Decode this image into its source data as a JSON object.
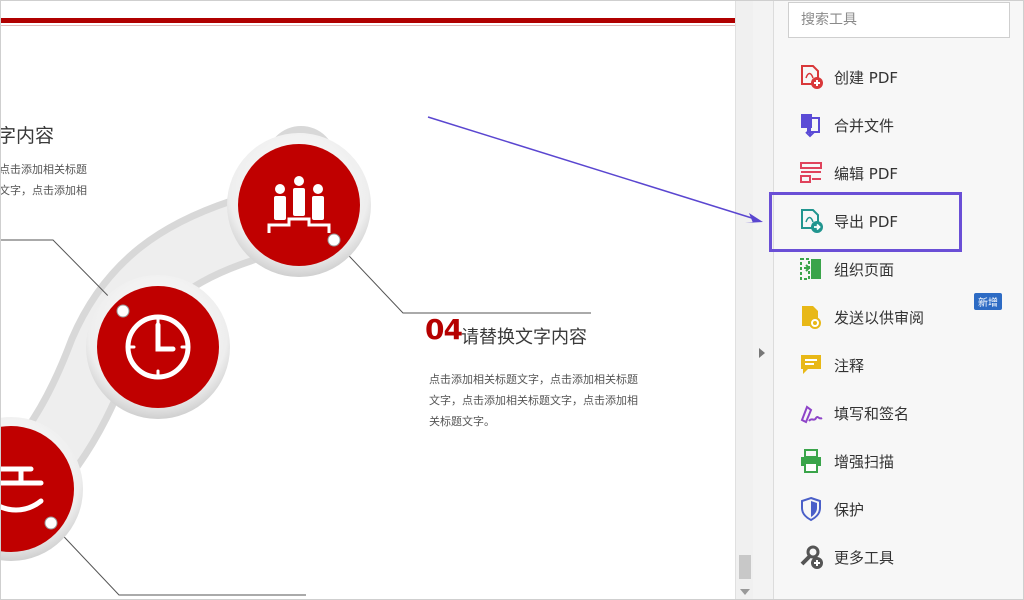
{
  "slide": {
    "left_heading": "字内容",
    "left_desc_1": "点击添加相关标题",
    "left_desc_2": "文字，点击添加相",
    "item_number": "04",
    "right_heading": "请替换文字内容",
    "right_desc_1": "点击添加相关标题文字，点击添加相关标题",
    "right_desc_2": "文字，点击添加相关标题文字，点击添加相",
    "right_desc_3": "关标题文字。"
  },
  "tools": {
    "search_placeholder": "搜索工具",
    "new_badge": "新增",
    "items": [
      {
        "label": "创建 PDF",
        "icon": "create-pdf-icon",
        "color": "#d9383a"
      },
      {
        "label": "合并文件",
        "icon": "combine-files-icon",
        "color": "#5b4bd6"
      },
      {
        "label": "编辑 PDF",
        "icon": "edit-pdf-icon",
        "color": "#e0435c"
      },
      {
        "label": "导出 PDF",
        "icon": "export-pdf-icon",
        "color": "#21958f"
      },
      {
        "label": "组织页面",
        "icon": "organize-pages-icon",
        "color": "#3aa44a"
      },
      {
        "label": "发送以供审阅",
        "icon": "send-for-review-icon",
        "color": "#e8b817"
      },
      {
        "label": "注释",
        "icon": "comment-icon",
        "color": "#e8b817"
      },
      {
        "label": "填写和签名",
        "icon": "fill-sign-icon",
        "color": "#8e44c8"
      },
      {
        "label": "增强扫描",
        "icon": "enhance-scan-icon",
        "color": "#3aa44a"
      },
      {
        "label": "保护",
        "icon": "protect-icon",
        "color": "#4a5fc8"
      },
      {
        "label": "更多工具",
        "icon": "more-tools-icon",
        "color": "#555555"
      }
    ]
  },
  "colors": {
    "slide_red": "#b50000",
    "highlight": "#6a4fd6"
  }
}
